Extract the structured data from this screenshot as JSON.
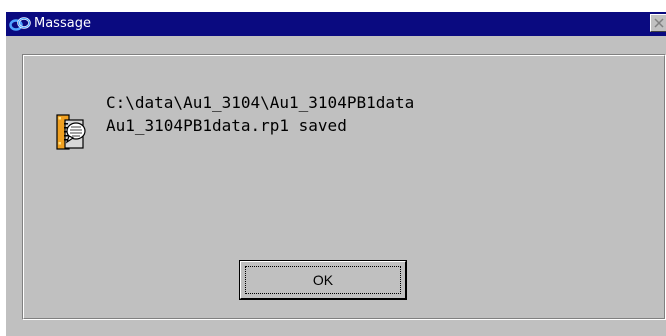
{
  "window": {
    "title": "Massage"
  },
  "message": {
    "line1": "C:\\data\\Au1_3104\\Au1_3104PB1data",
    "line2": "Au1_3104PB1data.rp1 saved"
  },
  "buttons": {
    "ok_label": "OK"
  },
  "icons": {
    "title_icon": "app-link-icon",
    "message_icon": "document-info-icon",
    "close_icon": "close-icon"
  },
  "colors": {
    "titlebar": "#0a0a80",
    "face": "#c0c0c0",
    "text": "#000000",
    "title_text": "#ffffff"
  }
}
